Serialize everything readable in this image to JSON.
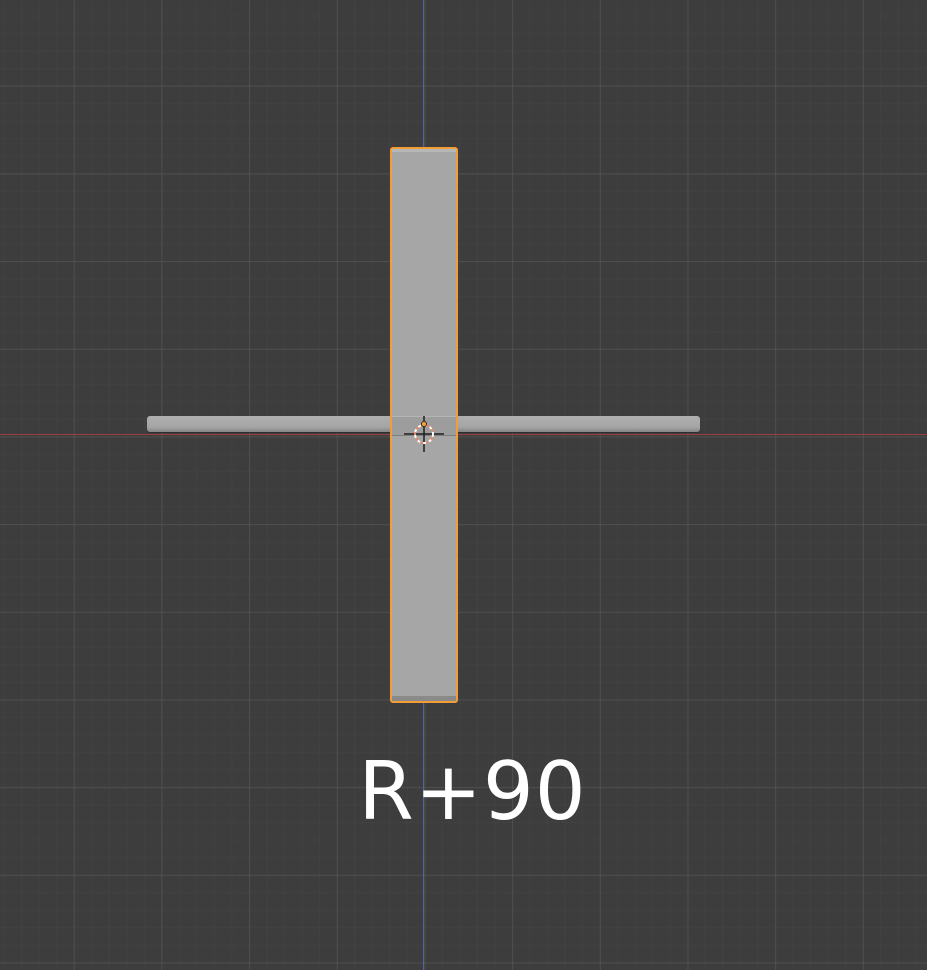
{
  "viewport": {
    "background_color": "#3d3d3d",
    "x_axis_color": "#9a3f45",
    "y_axis_color": "#4a68a8"
  },
  "objects": [
    {
      "name": "horizontal-bar",
      "selected": false,
      "color": "#a6a6a6"
    },
    {
      "name": "vertical-bar",
      "selected": true,
      "color": "#a6a6a6",
      "outline_color": "#f29d36"
    }
  ],
  "origin": {
    "icon": "origin-pivot-icon",
    "color": "#e8886a"
  },
  "overlay": {
    "shortcut_text": "R+90"
  }
}
